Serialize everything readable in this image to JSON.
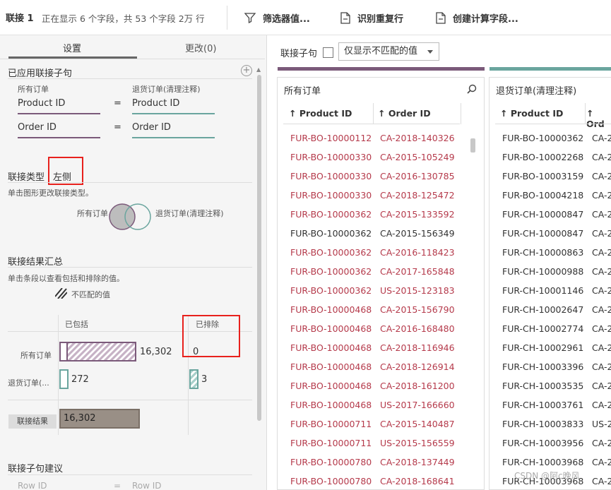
{
  "topbar": {
    "title": "联接 1",
    "info": "正在显示 6 个字段，共 53 个字段  2万 行",
    "filter_label": "筛选器值...",
    "dup_label": "识别重复行",
    "calc_label": "创建计算字段..."
  },
  "left": {
    "tabs": [
      "设置",
      "更改(0)"
    ],
    "applied_title": "已应用联接子句",
    "left_source": "所有订单",
    "right_source": "退货订单(清理注释)",
    "clauses": [
      {
        "left": "Product ID",
        "op": "=",
        "right": "Product ID"
      },
      {
        "left": "Order ID",
        "op": "=",
        "right": "Order ID"
      }
    ],
    "join_type_label": "联接类型",
    "join_type_value": "左侧",
    "join_type_hint": "单击图形更改联接类型。",
    "venn_left": "所有订单",
    "venn_right": "退货订单(清理注释)",
    "summary_title": "联接结果汇总",
    "summary_hint": "单击条段以查看包括和排除的值。",
    "unmatched_legend": "不匹配的值",
    "included_label": "已包括",
    "excluded_label": "已排除",
    "rows": [
      {
        "label": "所有订单",
        "included": "16,302",
        "excluded": "0"
      },
      {
        "label": "退货订单(...",
        "included": "272",
        "excluded": "3"
      }
    ],
    "result_label": "联接结果",
    "result_value": "16,302",
    "suggest_title": "联接子句建议",
    "suggest_left": "Row ID",
    "suggest_op": "=",
    "suggest_right": "Row ID"
  },
  "right": {
    "clause_label": "联接子句",
    "dropdown_value": "仅显示不匹配的值",
    "colors": {
      "left": "#7b5a7a",
      "right": "#6aa59e",
      "red_text": "#b53a4b"
    },
    "left_table": {
      "title": "所有订单",
      "columns": [
        "Product ID",
        "Order ID"
      ],
      "rows": [
        {
          "pid": "FUR-BO-10000112",
          "oid": "CA-2018-140326",
          "red": true
        },
        {
          "pid": "FUR-BO-10000330",
          "oid": "CA-2015-105249",
          "red": true
        },
        {
          "pid": "FUR-BO-10000330",
          "oid": "CA-2016-130785",
          "red": true
        },
        {
          "pid": "FUR-BO-10000330",
          "oid": "CA-2018-125472",
          "red": true
        },
        {
          "pid": "FUR-BO-10000362",
          "oid": "CA-2015-133592",
          "red": true
        },
        {
          "pid": "FUR-BO-10000362",
          "oid": "CA-2015-156349",
          "red": false
        },
        {
          "pid": "FUR-BO-10000362",
          "oid": "CA-2016-118423",
          "red": true
        },
        {
          "pid": "FUR-BO-10000362",
          "oid": "CA-2017-165848",
          "red": true
        },
        {
          "pid": "FUR-BO-10000362",
          "oid": "US-2015-123183",
          "red": true
        },
        {
          "pid": "FUR-BO-10000468",
          "oid": "CA-2015-156790",
          "red": true
        },
        {
          "pid": "FUR-BO-10000468",
          "oid": "CA-2016-168480",
          "red": true
        },
        {
          "pid": "FUR-BO-10000468",
          "oid": "CA-2018-116946",
          "red": true
        },
        {
          "pid": "FUR-BO-10000468",
          "oid": "CA-2018-126914",
          "red": true
        },
        {
          "pid": "FUR-BO-10000468",
          "oid": "CA-2018-161200",
          "red": true
        },
        {
          "pid": "FUR-BO-10000468",
          "oid": "US-2017-166660",
          "red": true
        },
        {
          "pid": "FUR-BO-10000711",
          "oid": "CA-2015-140487",
          "red": true
        },
        {
          "pid": "FUR-BO-10000711",
          "oid": "US-2015-156559",
          "red": true
        },
        {
          "pid": "FUR-BO-10000780",
          "oid": "CA-2018-137449",
          "red": true
        },
        {
          "pid": "FUR-BO-10000780",
          "oid": "CA-2018-168641",
          "red": true
        }
      ]
    },
    "right_table": {
      "title": "退货订单(清理注释)",
      "columns": [
        "Product ID",
        "Ord"
      ],
      "rows": [
        {
          "pid": "FUR-BO-10000362",
          "oid": "CA-2"
        },
        {
          "pid": "FUR-BO-10002268",
          "oid": "CA-2"
        },
        {
          "pid": "FUR-BO-10003159",
          "oid": "CA-2"
        },
        {
          "pid": "FUR-BO-10004218",
          "oid": "CA-2"
        },
        {
          "pid": "FUR-CH-10000847",
          "oid": "CA-2"
        },
        {
          "pid": "FUR-CH-10000847",
          "oid": "CA-2"
        },
        {
          "pid": "FUR-CH-10000863",
          "oid": "CA-2"
        },
        {
          "pid": "FUR-CH-10000988",
          "oid": "CA-2"
        },
        {
          "pid": "FUR-CH-10001146",
          "oid": "CA-2"
        },
        {
          "pid": "FUR-CH-10002647",
          "oid": "CA-2"
        },
        {
          "pid": "FUR-CH-10002774",
          "oid": "CA-2"
        },
        {
          "pid": "FUR-CH-10002961",
          "oid": "CA-2"
        },
        {
          "pid": "FUR-CH-10003396",
          "oid": "CA-2"
        },
        {
          "pid": "FUR-CH-10003535",
          "oid": "CA-2"
        },
        {
          "pid": "FUR-CH-10003761",
          "oid": "CA-2"
        },
        {
          "pid": "FUR-CH-10003833",
          "oid": "US-2"
        },
        {
          "pid": "FUR-CH-10003956",
          "oid": "CA-2"
        },
        {
          "pid": "FUR-CH-10003968",
          "oid": "CA-2"
        },
        {
          "pid": "FUR-CH-10003968",
          "oid": "CA-2"
        }
      ]
    }
  },
  "watermark": "CSDN @阿c晚风"
}
